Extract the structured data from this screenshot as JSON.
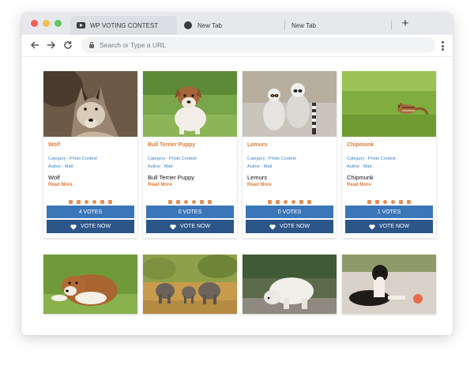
{
  "browser": {
    "tabs": [
      {
        "label": "WP VOTING CONTEST",
        "icon": "youtube-icon",
        "active": true
      },
      {
        "label": "New Tab",
        "icon": "globe-icon",
        "active": false
      },
      {
        "label": "New Tab",
        "icon": "",
        "active": false
      }
    ],
    "new_tab_icon": "plus-icon",
    "address_placeholder": "Search or Type a URL"
  },
  "contest": {
    "entries": [
      {
        "title": "Wolf",
        "category": "Category : Photo Contest",
        "author": "Author : Matt",
        "name": "Wolf",
        "read_more": "Read More",
        "votes": "4 VOTES",
        "vote_label": "VOTE NOW"
      },
      {
        "title": "Bull Terrier Puppy",
        "category": "Category : Photo Contest",
        "author": "Author : Matt",
        "name": "Bull Terrier Puppy",
        "read_more": "Read More",
        "votes": "0 VOTES",
        "vote_label": "VOTE NOW"
      },
      {
        "title": "Lemurs",
        "category": "Category : Photo Contest",
        "author": "Author : Matt",
        "name": "Lemurs",
        "read_more": "Read More",
        "votes": "0 VOTES",
        "vote_label": "VOTE NOW"
      },
      {
        "title": "Chipmunk",
        "category": "Category : Photo Contest",
        "author": "Author : Matt",
        "name": "Chipmunk",
        "read_more": "Read More",
        "votes": "1 VOTES",
        "vote_label": "VOTE NOW"
      }
    ],
    "share_icons": [
      "facebook-icon",
      "twitter-icon",
      "pinterest-icon",
      "reddit-icon",
      "linkedin-icon",
      "tumblr-icon"
    ],
    "colors": {
      "accent": "#e07b39",
      "votes_bg": "#3b76b9",
      "vote_button_bg": "#2c5588",
      "link": "#3b82c4"
    }
  }
}
